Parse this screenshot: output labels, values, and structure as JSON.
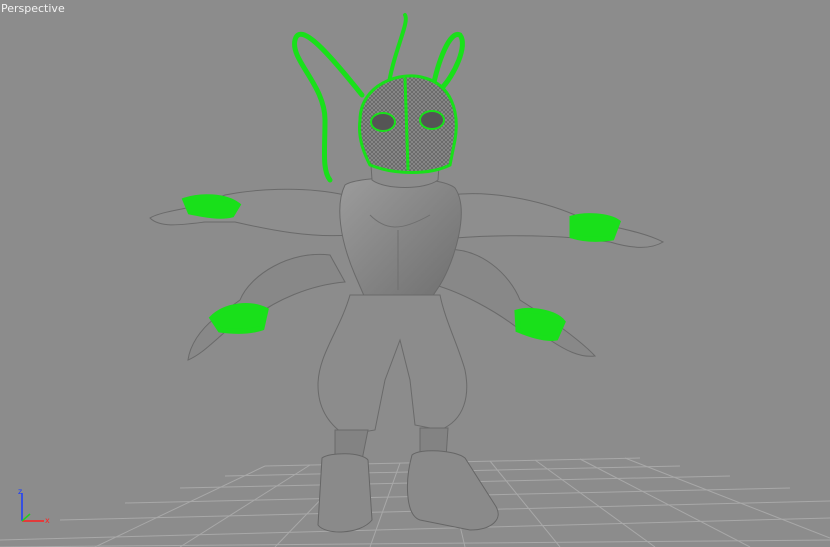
{
  "viewport": {
    "label": "Perspective",
    "background": "#8c8c8c",
    "selection_color": "#19e01a",
    "model_color": "#8f8f8f"
  },
  "axis_tripod": {
    "icon": "axis-tripod-icon",
    "z_label": "z",
    "x_label": "x",
    "z_color": "#1a3cff",
    "x_color": "#ff2020",
    "y_color": "#20d020"
  },
  "grid": {
    "icon": "home-grid",
    "color": "#a6a6a6"
  }
}
